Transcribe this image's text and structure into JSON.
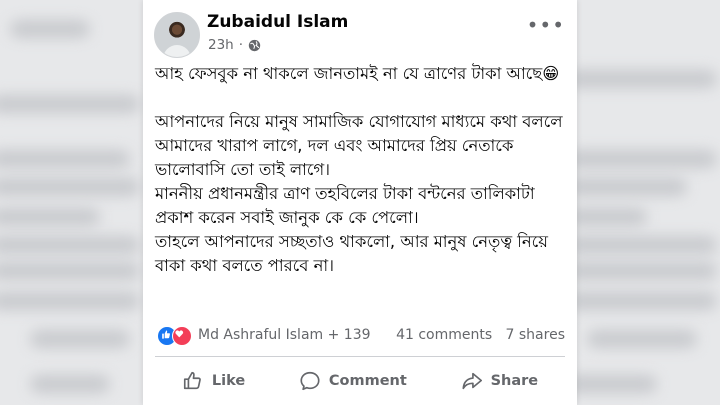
{
  "post": {
    "author": "Zubaidul Islam",
    "time": "23h",
    "paragraphs": [
      "আহ ফেসবুক না থাকলে জানতামই না যে ত্রাণের টাকা আছে😁",
      "আপনাদের নিয়ে মানুষ সামাজিক যোগাযোগ মাধ্যমে কথা বললে আমাদের খারাপ লাগে, দল এবং আমাদের প্রিয় নেতাকে ভালোবাসি তো তাই লাগে।",
      "মাননীয় প্রধানমন্ত্রীর ত্রাণ তহবিলের টাকা বন্টনের তালিকাটা প্রকাশ করেন সবাই জানুক কে কে পেলো।",
      "তাহলে আপনাদের সচ্ছতাও থাকলো, আর মানুষ নেতৃত্ব নিয়ে বাকা কথা বলতে পারবে না।"
    ]
  },
  "reactions": {
    "names": "Md Ashraful Islam + 139",
    "comments": "41 comments",
    "shares": "7 shares"
  },
  "actions": {
    "like": "Like",
    "comment": "Comment",
    "share": "Share"
  },
  "icons": {
    "globe": "globe-icon",
    "more": "more-options-icon",
    "like_reaction": "like-reaction-icon",
    "love_reaction": "love-reaction-icon"
  },
  "colors": {
    "like_blue": "#1877f2",
    "love_red": "#f33e58",
    "secondary_text": "#65676b"
  }
}
